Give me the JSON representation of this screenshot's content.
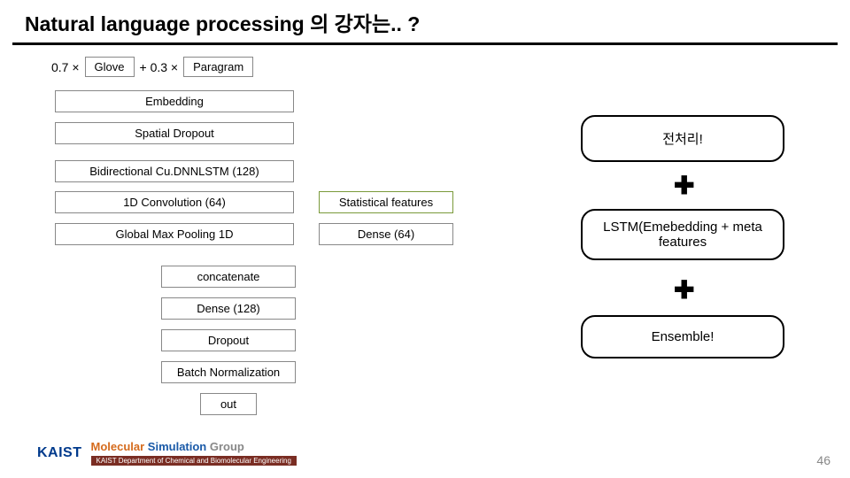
{
  "title": "Natural language processing 의 강자는.. ?",
  "formula": {
    "coef1": "0.7 ×",
    "tag1": "Glove",
    "plus": "+ 0.3 ×",
    "tag2": "Paragram"
  },
  "blocks": {
    "embedding": "Embedding",
    "spatial_dropout": "Spatial Dropout",
    "bilstm": "Bidirectional Cu.DNNLSTM (128)",
    "conv1d": "1D Convolution (64)",
    "gmp": "Global Max Pooling 1D",
    "stat": "Statistical features",
    "dense64": "Dense (64)",
    "concat": "concatenate",
    "dense128": "Dense (128)",
    "dropout": "Dropout",
    "bn": "Batch Normalization",
    "out": "out"
  },
  "callouts": {
    "preprocess": "전처리!",
    "lstm": "LSTM(Emebedding + meta features",
    "ensemble": "Ensemble!"
  },
  "footer": {
    "kaist": "KAIST",
    "msg_m": "Molecular ",
    "msg_s": "Simulation ",
    "msg_g": "Group",
    "dept": "KAIST  Department of Chemical and Biomolecular Engineering"
  },
  "pagenum": "46"
}
